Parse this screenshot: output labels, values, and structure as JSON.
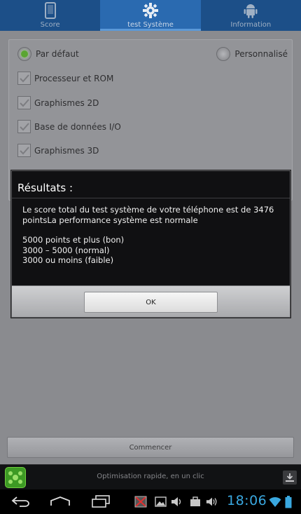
{
  "tabs": [
    {
      "label": "Score",
      "icon": "phone-icon"
    },
    {
      "label": "test Système",
      "icon": "gear-icon"
    },
    {
      "label": "Information",
      "icon": "android-icon"
    }
  ],
  "options": {
    "default_label": "Par défaut",
    "custom_label": "Personnalisé",
    "checks": [
      "Processeur et ROM",
      "Graphismes 2D",
      "Base de données I/O",
      "Graphismes 3D"
    ]
  },
  "start_button": "Commencer",
  "dialog": {
    "title": "Résultats :",
    "line1": "Le score total du test système de votre téléphone est de 3476 pointsLa performance système est normale",
    "range1": "5000 points et plus (bon)",
    "range2": "3000 – 5000 (normal)",
    "range3": "3000 ou moins (faible)",
    "ok": "OK"
  },
  "ad": {
    "text": "Optimisation rapide, en un clic"
  },
  "status": {
    "time": "18:06"
  },
  "colors": {
    "tab_bar": "#1c4f88",
    "tab_active": "#2a6ab0",
    "clock": "#3aa8e0",
    "radio_selected": "#5aa532"
  }
}
